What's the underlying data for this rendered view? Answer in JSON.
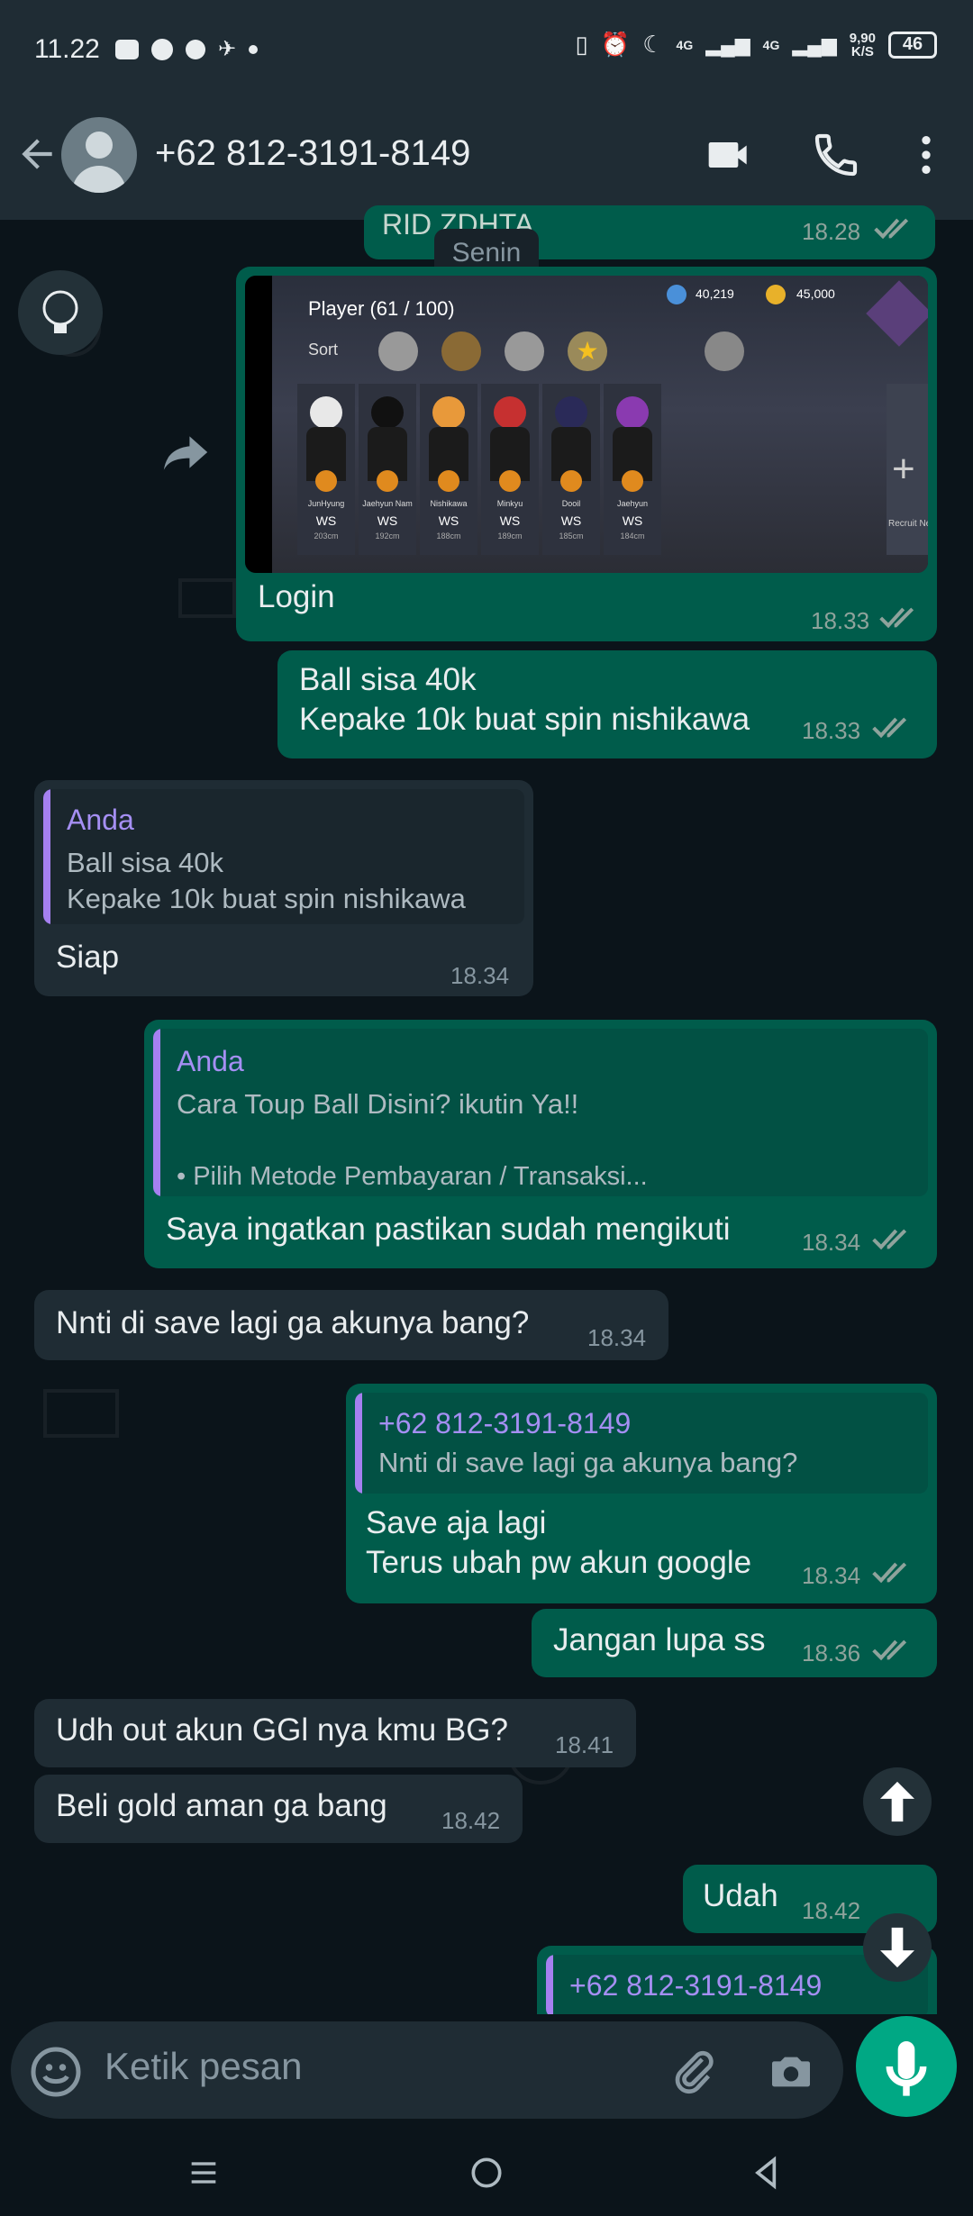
{
  "status_bar": {
    "time": "11.22",
    "net_speed_top": "9,90",
    "net_speed_bottom": "K/S",
    "signal1": "4G",
    "signal2": "4G",
    "battery": "46"
  },
  "header": {
    "contact_name": "+62 812-3191-8149",
    "icons": [
      "back-arrow-icon",
      "video-call-icon",
      "phone-icon",
      "more-vert-icon"
    ]
  },
  "chat": {
    "date_pill": "Senin",
    "top_partial": {
      "text": "RID ZDHTA",
      "time": "18.28"
    },
    "image_msg": {
      "game_header": "Player (61 / 100)",
      "sort_label": "Sort",
      "coins1": "40,219",
      "coins2": "45,000",
      "players": [
        {
          "name": "JunHyung",
          "pos": "WS",
          "height": "203cm"
        },
        {
          "name": "Jaehyun Nam",
          "pos": "WS",
          "height": "192cm"
        },
        {
          "name": "Nishikawa",
          "pos": "WS",
          "height": "188cm"
        },
        {
          "name": "Minkyu",
          "pos": "WS",
          "height": "189cm"
        },
        {
          "name": "Dooil",
          "pos": "WS",
          "height": "185cm"
        },
        {
          "name": "Jaehyun",
          "pos": "WS",
          "height": "184cm"
        }
      ],
      "recruit_label": "Recruit Ne",
      "caption": "Login",
      "time": "18.33"
    },
    "messages": [
      {
        "id": "m1",
        "line1": "Ball sisa 40k",
        "line2": "Kepake 10k buat spin nishikawa",
        "time": "18.33"
      },
      {
        "id": "m2",
        "quote_name": "Anda",
        "quote_line1": "Ball sisa 40k",
        "quote_line2": "Kepake 10k buat spin nishikawa",
        "text": "Siap",
        "time": "18.34"
      },
      {
        "id": "m3",
        "quote_name": "Anda",
        "quote_line1": "Cara Toup Ball Disini? ikutin Ya!!",
        "quote_line2": "• Pilih Metode Pembayaran / Transaksi...",
        "text": "Saya ingatkan pastikan sudah mengikuti",
        "time": "18.34"
      },
      {
        "id": "m4",
        "text": "Nnti di save lagi ga akunya bang?",
        "time": "18.34"
      },
      {
        "id": "m5",
        "quote_name": "+62 812-3191-8149",
        "quote_line1": "Nnti di save lagi ga akunya bang?",
        "line1": "Save aja lagi",
        "line2": "Terus ubah pw akun google",
        "time": "18.34"
      },
      {
        "id": "m6",
        "text": "Jangan lupa ss",
        "time": "18.36"
      },
      {
        "id": "m7",
        "text": "Udh out akun GGl nya kmu BG?",
        "time": "18.41"
      },
      {
        "id": "m8",
        "text": "Beli gold aman ga bang",
        "time": "18.42"
      },
      {
        "id": "m9",
        "text": "Udah",
        "time": "18.42"
      },
      {
        "id": "m10",
        "quote_name": "+62 812-3191-8149"
      }
    ]
  },
  "composer": {
    "placeholder": "Ketik pesan"
  },
  "colors": {
    "outgoing": "#005c4b",
    "incoming": "#1f2c34",
    "accent": "#00a884",
    "quote_name": "#a58ff3"
  }
}
